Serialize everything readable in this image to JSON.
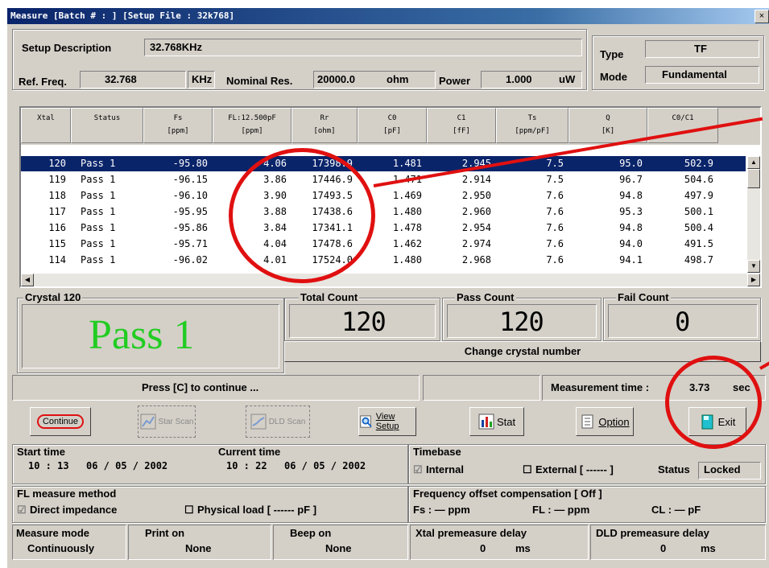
{
  "window": {
    "title": "Measure [Batch # : ] [Setup File : 32k768]",
    "close_label": "×"
  },
  "header": {
    "setup_description_label": "Setup Description",
    "setup_description_value": "32.768KHz",
    "type_label": "Type",
    "type_value": "TF",
    "ref_freq_label": "Ref. Freq.",
    "ref_freq_value": "32.768",
    "ref_freq_unit": "KHz",
    "nominal_res_label": "Nominal Res.",
    "nominal_res_value": "20000.0",
    "nominal_res_unit": "ohm",
    "power_label": "Power",
    "power_value": "1.000",
    "power_unit": "uW",
    "mode_label": "Mode",
    "mode_value": "Fundamental"
  },
  "table": {
    "headers": [
      {
        "l1": "Xtal",
        "l2": ""
      },
      {
        "l1": "Status",
        "l2": ""
      },
      {
        "l1": "Fs",
        "l2": "[ppm]"
      },
      {
        "l1": "FL:12.500pF",
        "l2": "[ppm]"
      },
      {
        "l1": "Rr",
        "l2": "[ohm]"
      },
      {
        "l1": "C0",
        "l2": "[pF]"
      },
      {
        "l1": "C1",
        "l2": "[fF]"
      },
      {
        "l1": "Ts",
        "l2": "[ppm/pF]"
      },
      {
        "l1": "Q",
        "l2": "[K]"
      },
      {
        "l1": "C0/C1",
        "l2": ""
      }
    ],
    "rows": [
      [
        "120",
        "Pass 1",
        "-95.80",
        "4.06",
        "17398.9",
        "1.481",
        "2.945",
        "7.5",
        "95.0",
        "502.9"
      ],
      [
        "119",
        "Pass 1",
        "-96.15",
        "3.86",
        "17446.9",
        "1.471",
        "2.914",
        "7.5",
        "96.7",
        "504.6"
      ],
      [
        "118",
        "Pass 1",
        "-96.10",
        "3.90",
        "17493.5",
        "1.469",
        "2.950",
        "7.6",
        "94.8",
        "497.9"
      ],
      [
        "117",
        "Pass 1",
        "-95.95",
        "3.88",
        "17438.6",
        "1.480",
        "2.960",
        "7.6",
        "95.3",
        "500.1"
      ],
      [
        "116",
        "Pass 1",
        "-95.86",
        "3.84",
        "17341.1",
        "1.478",
        "2.954",
        "7.6",
        "94.8",
        "500.4"
      ],
      [
        "115",
        "Pass 1",
        "-95.71",
        "4.04",
        "17478.6",
        "1.462",
        "2.974",
        "7.6",
        "94.0",
        "491.5"
      ],
      [
        "114",
        "Pass 1",
        "-96.02",
        "4.01",
        "17524.0",
        "1.480",
        "2.968",
        "7.6",
        "94.1",
        "498.7"
      ]
    ]
  },
  "crystal": {
    "group_label": "Crystal 120",
    "result": "Pass 1",
    "result_color": "#22cc22"
  },
  "counts": {
    "total_label": "Total Count",
    "total_value": "120",
    "pass_label": "Pass Count",
    "pass_value": "120",
    "fail_label": "Fail Count",
    "fail_value": "0",
    "change_button": "Change crystal number"
  },
  "status": {
    "prompt": "Press [C] to continue ...",
    "measurement_time_label": "Measurement time :",
    "measurement_time_value": "3.73",
    "measurement_time_unit": "sec"
  },
  "toolbar": {
    "continue": "Continue",
    "star_scan": "Star Scan",
    "dld_scan": "DLD Scan",
    "view_setup": "View Setup",
    "stat": "Stat",
    "option": "Option",
    "exit": "Exit"
  },
  "info": {
    "start_time_label": "Start time",
    "start_time": "10 : 13",
    "start_date": "06 / 05 / 2002",
    "current_time_label": "Current time",
    "current_time": "10 : 22",
    "current_date": "06 / 05 / 2002",
    "timebase_label": "Timebase",
    "timebase_internal": "Internal",
    "timebase_external": "External [ ------ ]",
    "timebase_status_label": "Status",
    "timebase_status_value": "Locked",
    "fl_method_label": "FL measure method",
    "fl_direct": "Direct impedance",
    "fl_physical": "Physical load [ ------ pF ]",
    "freq_offset_label": "Frequency offset compensation [ Off ]",
    "fs_offset": "Fs :  —  ppm",
    "fl_offset": "FL :  —  ppm",
    "cl_offset": "CL :  —  pF",
    "measure_mode_label": "Measure mode",
    "measure_mode_value": "Continuously",
    "print_on_label": "Print on",
    "print_on_value": "None",
    "beep_on_label": "Beep on",
    "beep_on_value": "None",
    "xtal_delay_label": "Xtal premeasure delay",
    "xtal_delay_value": "0",
    "xtal_delay_unit": "ms",
    "dld_delay_label": "DLD premeasure delay",
    "dld_delay_value": "0",
    "dld_delay_unit": "ms"
  },
  "colors": {
    "annotation": "#e01010",
    "selection": "#0a246a",
    "pass_green": "#22cc22"
  }
}
